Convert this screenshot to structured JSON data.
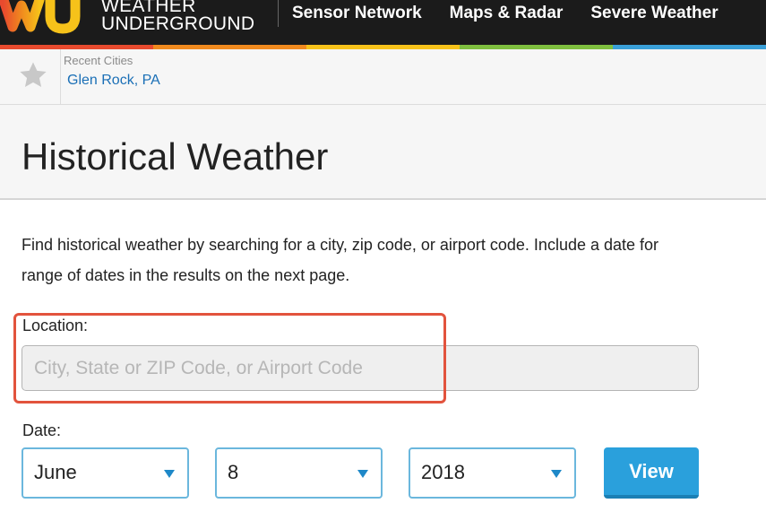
{
  "header": {
    "logo": {
      "line1": "WEATHER",
      "line2": "UNDERGROUND",
      "mark_letters": "WU"
    },
    "nav": [
      {
        "label": "Sensor Network"
      },
      {
        "label": "Maps & Radar"
      },
      {
        "label": "Severe Weather"
      }
    ],
    "stripe_colors": [
      "#e84a2e",
      "#f08a1e",
      "#f6c21a",
      "#7fbf3f",
      "#3aa0d8"
    ]
  },
  "recent": {
    "icon": "star-icon",
    "label": "Recent Cities",
    "city": "Glen Rock, PA"
  },
  "page": {
    "title": "Historical Weather",
    "intro_line1": "Find historical weather by searching for a city, zip code, or airport code. Include a date for",
    "intro_line2": "range of dates in the results on the next page."
  },
  "form": {
    "location_label": "Location:",
    "location_placeholder": "City, State or ZIP Code, or Airport Code",
    "location_value": "",
    "date_label": "Date:",
    "month": "June",
    "day": "8",
    "year": "2018",
    "view_label": "View"
  },
  "colors": {
    "accent": "#2aa0dc",
    "highlight": "#e2533d",
    "link": "#1a6fb6"
  }
}
